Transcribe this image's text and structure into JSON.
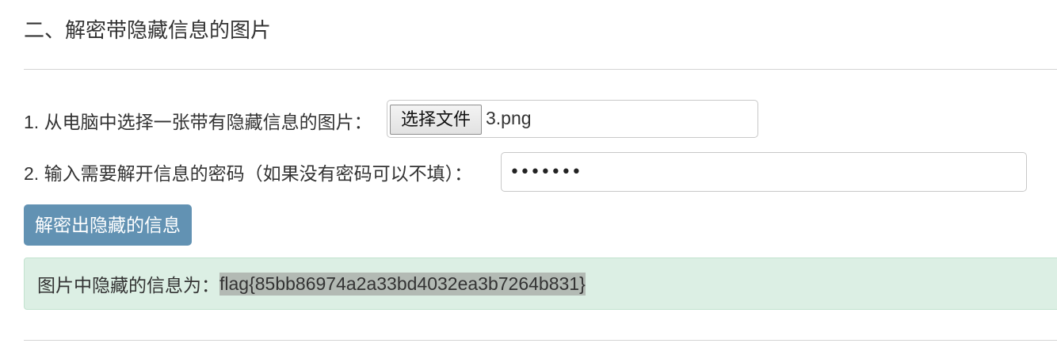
{
  "section": {
    "title": "二、解密带隐藏信息的图片"
  },
  "step1": {
    "label": "1. 从电脑中选择一张带有隐藏信息的图片：",
    "file_button_label": "选择文件",
    "file_name": "3.png"
  },
  "step2": {
    "label": "2. 输入需要解开信息的密码（如果没有密码可以不填）：",
    "password_value": "1234567"
  },
  "decrypt_button": {
    "label": "解密出隐藏的信息"
  },
  "result": {
    "label": "图片中隐藏的信息为：",
    "value": "flag{85bb86974a2a33bd4032ea3b7264b831}"
  },
  "colors": {
    "button_primary": "#6292b3",
    "result_background": "#dcefe4",
    "result_highlight": "#b3bab4"
  }
}
